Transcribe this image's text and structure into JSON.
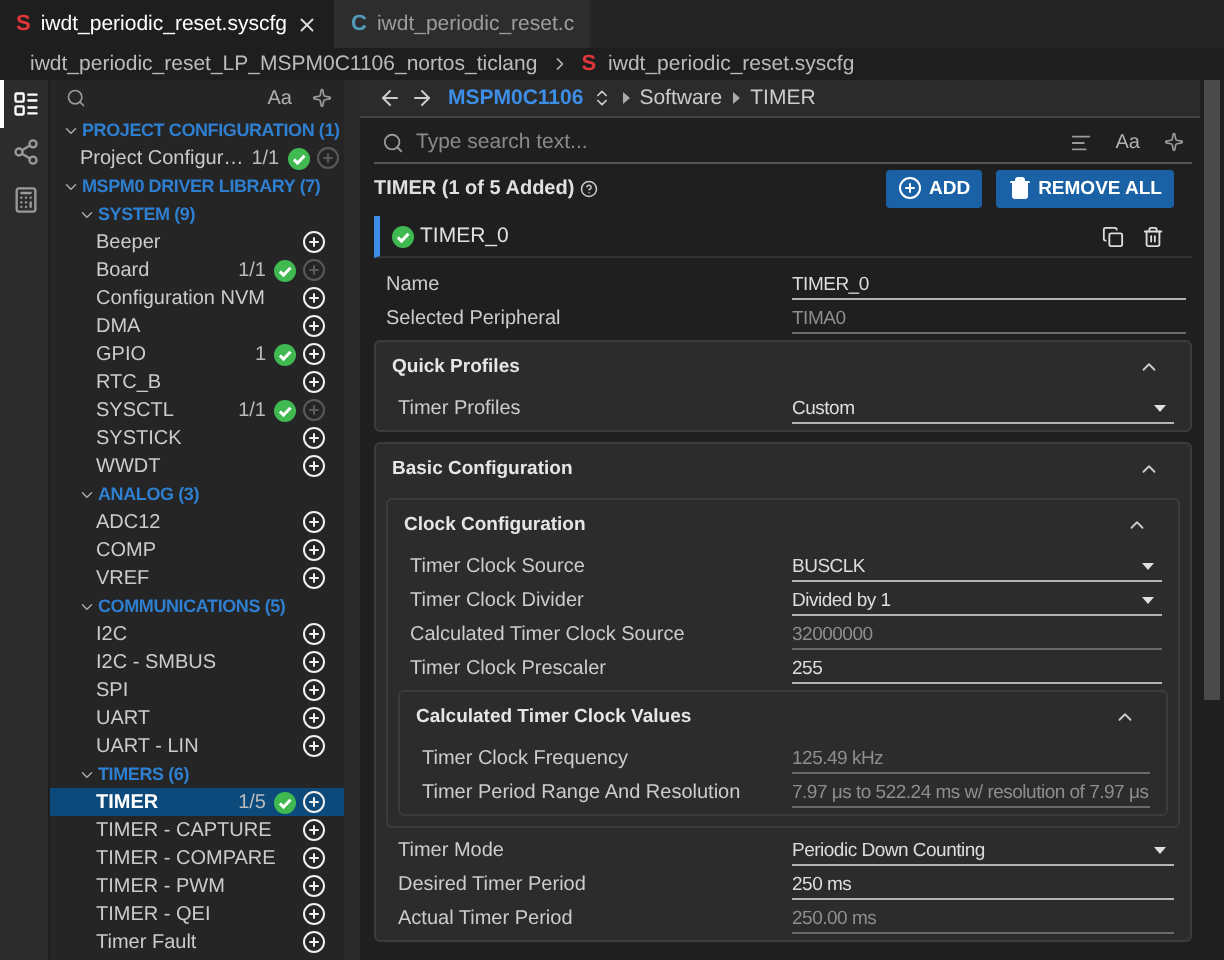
{
  "tabs": [
    {
      "icon": "S",
      "label": "iwdt_periodic_reset.syscfg",
      "selected": true,
      "closable": true
    },
    {
      "icon": "C",
      "label": "iwdt_periodic_reset.c",
      "selected": false,
      "closable": false
    }
  ],
  "breadcrumb": {
    "project": "iwdt_periodic_reset_LP_MSPM0C1106_nortos_ticlang",
    "file_icon": "S",
    "file": "iwdt_periodic_reset.syscfg"
  },
  "activity_bar": [
    {
      "kind": "list",
      "selected": true
    },
    {
      "kind": "network",
      "selected": false
    },
    {
      "kind": "calculator",
      "selected": false
    }
  ],
  "sidebar": {
    "case_label": "Aa",
    "tree": [
      {
        "label": "PROJECT CONFIGURATION (1)",
        "expanded": true,
        "children": [
          {
            "label": "Project Configur…",
            "count": "1/1",
            "added": true,
            "addable": false,
            "selected": false
          }
        ]
      },
      {
        "label": "MSPM0 DRIVER LIBRARY (7)",
        "expanded": true,
        "children": [
          {
            "label": "SYSTEM (9)",
            "expanded": true,
            "children": [
              {
                "label": "Beeper",
                "added": false,
                "addable": true,
                "selected": false
              },
              {
                "label": "Board",
                "count": "1/1",
                "added": true,
                "addable": false,
                "selected": false
              },
              {
                "label": "Configuration NVM",
                "added": false,
                "addable": true,
                "selected": false
              },
              {
                "label": "DMA",
                "added": false,
                "addable": true,
                "selected": false
              },
              {
                "label": "GPIO",
                "count": "1",
                "added": true,
                "addable": true,
                "selected": false
              },
              {
                "label": "RTC_B",
                "added": false,
                "addable": true,
                "selected": false
              },
              {
                "label": "SYSCTL",
                "count": "1/1",
                "added": true,
                "addable": false,
                "selected": false
              },
              {
                "label": "SYSTICK",
                "added": false,
                "addable": true,
                "selected": false
              },
              {
                "label": "WWDT",
                "added": false,
                "addable": true,
                "selected": false
              }
            ]
          },
          {
            "label": "ANALOG (3)",
            "expanded": true,
            "children": [
              {
                "label": "ADC12",
                "added": false,
                "addable": true,
                "selected": false
              },
              {
                "label": "COMP",
                "added": false,
                "addable": true,
                "selected": false
              },
              {
                "label": "VREF",
                "added": false,
                "addable": true,
                "selected": false
              }
            ]
          },
          {
            "label": "COMMUNICATIONS (5)",
            "expanded": true,
            "children": [
              {
                "label": "I2C",
                "added": false,
                "addable": true,
                "selected": false
              },
              {
                "label": "I2C - SMBUS",
                "added": false,
                "addable": true,
                "selected": false
              },
              {
                "label": "SPI",
                "added": false,
                "addable": true,
                "selected": false
              },
              {
                "label": "UART",
                "added": false,
                "addable": true,
                "selected": false
              },
              {
                "label": "UART - LIN",
                "added": false,
                "addable": true,
                "selected": false
              }
            ]
          },
          {
            "label": "TIMERS (6)",
            "expanded": true,
            "children": [
              {
                "label": "TIMER",
                "count": "1/5",
                "added": true,
                "addable": true,
                "selected": true
              },
              {
                "label": "TIMER - CAPTURE",
                "added": false,
                "addable": true,
                "selected": false
              },
              {
                "label": "TIMER - COMPARE",
                "added": false,
                "addable": true,
                "selected": false
              },
              {
                "label": "TIMER - PWM",
                "added": false,
                "addable": true,
                "selected": false
              },
              {
                "label": "TIMER - QEI",
                "added": false,
                "addable": true,
                "selected": false
              },
              {
                "label": "Timer Fault",
                "added": false,
                "addable": true,
                "selected": false
              }
            ]
          }
        ]
      }
    ]
  },
  "nav": {
    "device": "MSPM0C1106",
    "path": [
      "Software",
      "TIMER"
    ]
  },
  "search": {
    "placeholder": "Type search text...",
    "case_label": "Aa"
  },
  "module": {
    "title": "TIMER (1 of 5 Added)",
    "buttons": [
      {
        "kind": "add",
        "label": "ADD"
      },
      {
        "kind": "remove",
        "label": "REMOVE ALL"
      }
    ],
    "instance": {
      "name": "TIMER_0",
      "valid": true
    }
  },
  "settings": [
    {
      "kind": "text",
      "label": "Name",
      "value": "TIMER_0"
    },
    {
      "kind": "readonly",
      "label": "Selected Peripheral",
      "value": "TIMA0"
    },
    {
      "kind": "section",
      "title": "Quick Profiles",
      "expanded": true,
      "items": [
        {
          "kind": "select",
          "label": "Timer Profiles",
          "value": "Custom"
        }
      ]
    },
    {
      "kind": "section",
      "title": "Basic Configuration",
      "expanded": true,
      "items": [
        {
          "kind": "section",
          "title": "Clock Configuration",
          "expanded": true,
          "items": [
            {
              "kind": "select",
              "label": "Timer Clock Source",
              "value": "BUSCLK"
            },
            {
              "kind": "select",
              "label": "Timer Clock Divider",
              "value": "Divided by 1"
            },
            {
              "kind": "readonly",
              "label": "Calculated Timer Clock Source",
              "value": "32000000"
            },
            {
              "kind": "text",
              "label": "Timer Clock Prescaler",
              "value": "255"
            },
            {
              "kind": "section",
              "title": "Calculated Timer Clock Values",
              "expanded": true,
              "items": [
                {
                  "kind": "readonly",
                  "label": "Timer Clock Frequency",
                  "value": "125.49 kHz"
                },
                {
                  "kind": "readonly",
                  "label": "Timer Period Range And Resolution",
                  "value": "7.97 μs to 522.24 ms w/ resolution of 7.97 μs"
                }
              ]
            }
          ]
        },
        {
          "kind": "select",
          "label": "Timer Mode",
          "value": "Periodic Down Counting"
        },
        {
          "kind": "text",
          "label": "Desired Timer Period",
          "value": "250 ms"
        },
        {
          "kind": "readonly",
          "label": "Actual Timer Period",
          "value": "250.00 ms"
        }
      ]
    }
  ]
}
